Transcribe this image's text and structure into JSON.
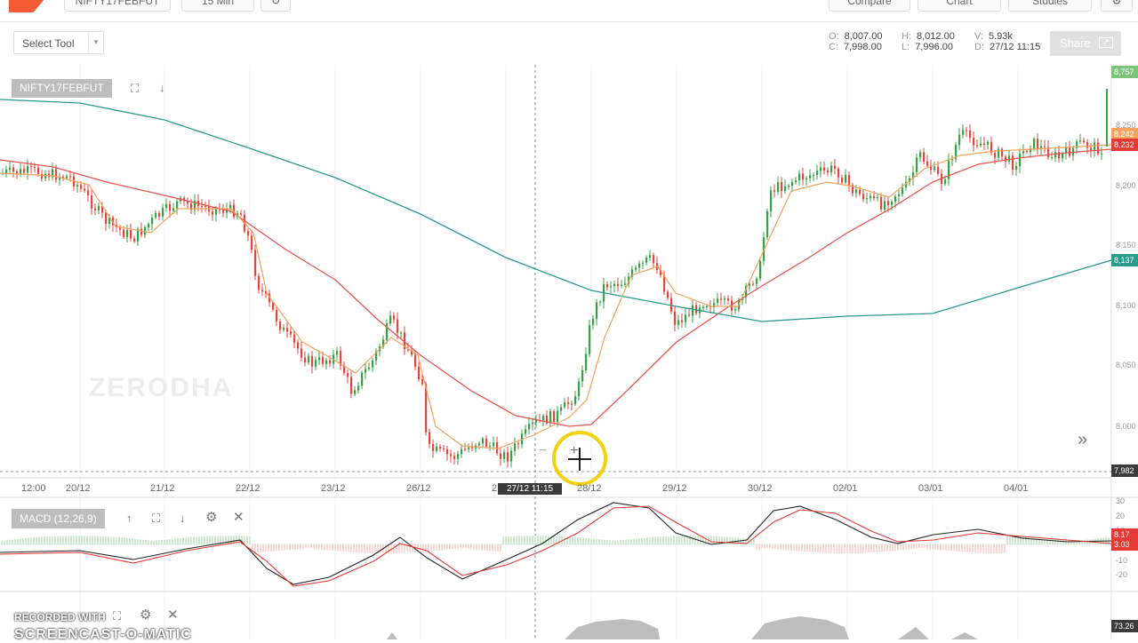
{
  "header": {
    "symbol_select": "NIFTY17FEBFUT",
    "interval_select": "15 Min",
    "compare_label": "Compare",
    "chart_label": "Chart",
    "studies_label": "Studies"
  },
  "toolbar": {
    "select_tool_label": "Select Tool",
    "ohlc": {
      "o_key": "O:",
      "o_val": "8,007.00",
      "h_key": "H:",
      "h_val": "8,012.00",
      "v_key": "V:",
      "v_val": "5.93k",
      "c_key": "C:",
      "c_val": "7,998.00",
      "l_key": "L:",
      "l_val": "7,996.00",
      "d_key": "D:",
      "d_val": "27/12 11:15"
    },
    "share_label": "Share"
  },
  "chart": {
    "symbol_label": "NIFTY17FEBFUT",
    "watermark": "ZERODHA",
    "crosshair_date": "27/12 11:15",
    "x_labels": [
      "12:00",
      "20/12",
      "21/12",
      "22/12",
      "23/12",
      "26/12",
      "2",
      "28/12",
      "29/12",
      "30/12",
      "02/01",
      "03/01",
      "04/01"
    ],
    "y_labels": [
      "8,250",
      "8,200",
      "8,150",
      "8,100",
      "8,050",
      "8,000"
    ],
    "price_tags": {
      "last": "8,757",
      "orange": "8,242",
      "red": "8,232",
      "teal": "8,137",
      "crosshair": "7,982"
    },
    "colors": {
      "up": "#36a145",
      "down": "#e6453d",
      "ema_fast": "#f2a35e",
      "ema_mid": "#e5564e",
      "ema_slow": "#2a9a8a"
    }
  },
  "macd": {
    "label": "MACD (12,26,9)",
    "y_labels": [
      "30",
      "20",
      "10",
      "-10",
      "-20"
    ],
    "price_tags": {
      "a": "8.17",
      "b": "3.03"
    }
  },
  "volume": {
    "price_tag": "73.26"
  },
  "recorder": {
    "label": "RECORDED WITH",
    "brand": "SCREENCAST-O-MATIC"
  }
}
